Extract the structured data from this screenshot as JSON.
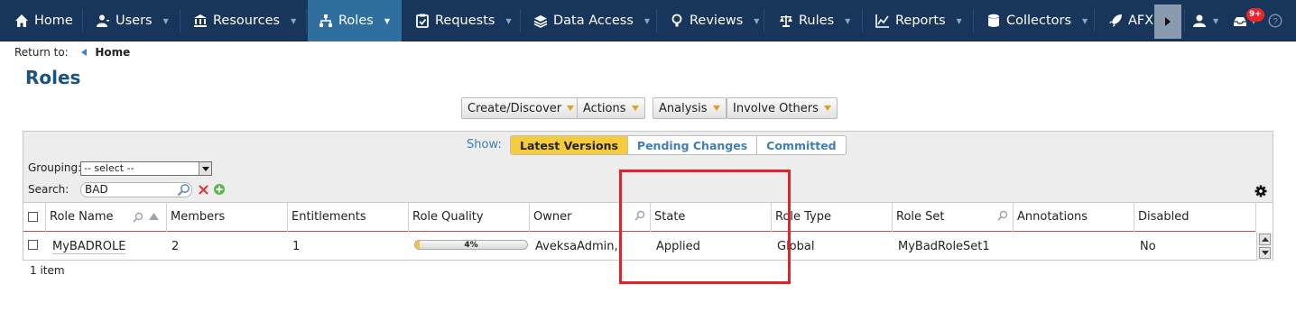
{
  "nav": {
    "items": [
      {
        "label": "Home",
        "icon": "home-icon"
      },
      {
        "label": "Users",
        "icon": "users-icon"
      },
      {
        "label": "Resources",
        "icon": "resources-icon"
      },
      {
        "label": "Roles",
        "icon": "roles-icon",
        "active": true
      },
      {
        "label": "Requests",
        "icon": "requests-icon"
      },
      {
        "label": "Data Access",
        "icon": "data-access-icon"
      },
      {
        "label": "Reviews",
        "icon": "reviews-icon"
      },
      {
        "label": "Rules",
        "icon": "rules-icon"
      },
      {
        "label": "Reports",
        "icon": "reports-icon"
      },
      {
        "label": "Collectors",
        "icon": "collectors-icon"
      },
      {
        "label": "AFX",
        "icon": "rocket-icon"
      }
    ],
    "notification_count": "9+",
    "accent_color": "#2f6f9f",
    "bar_color": "#18365c"
  },
  "breadcrumb": {
    "prefix": "Return to:",
    "home": "Home"
  },
  "page": {
    "title": "Roles"
  },
  "toolbar": {
    "create": "Create/Discover",
    "actions": "Actions",
    "analysis": "Analysis",
    "involve": "Involve Others"
  },
  "filter": {
    "show_label": "Show:",
    "tabs": [
      "Latest Versions",
      "Pending Changes",
      "Committed"
    ],
    "selected_tab": "Latest Versions",
    "grouping_label": "Grouping:",
    "grouping_value": "-- select --",
    "search_label": "Search:",
    "search_value": "BAD"
  },
  "table": {
    "columns": [
      "Role Name",
      "Members",
      "Entitlements",
      "Role Quality",
      "Owner",
      "State",
      "Role Type",
      "Role Set",
      "Annotations",
      "Disabled"
    ],
    "rows": [
      {
        "role_name": "MyBADROLE",
        "members": "2",
        "entitlements": "1",
        "role_quality": "4%",
        "role_quality_value": 4,
        "owner": "AveksaAdmin,",
        "state": "Applied",
        "role_type": "Global",
        "role_set": "MyBadRoleSet1",
        "annotations": "",
        "disabled": "No"
      }
    ],
    "item_count": "1 item"
  },
  "colors": {
    "highlight": "#e0232a",
    "title": "#1b5281",
    "selected_tab": "#f7cc3a"
  }
}
